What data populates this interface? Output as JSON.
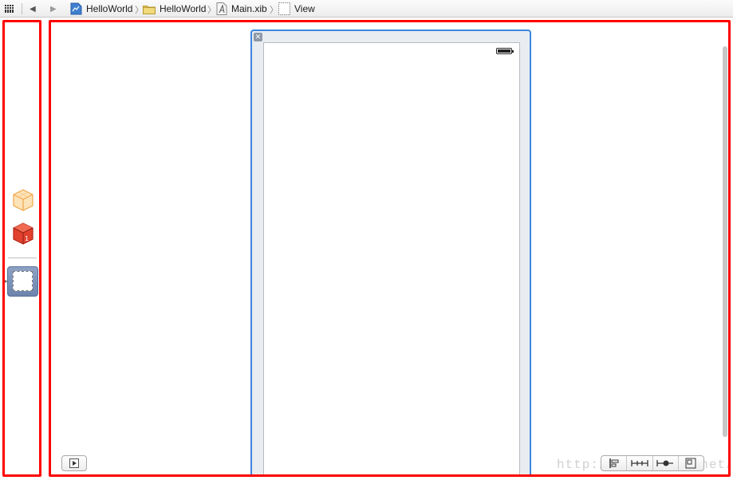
{
  "jump_bar": {
    "related_items_icon": "grid-icon",
    "back_icon": "back-arrow-icon",
    "forward_icon": "forward-arrow-icon",
    "crumbs": [
      {
        "label": "HelloWorld",
        "icon": "project-icon"
      },
      {
        "label": "HelloWorld",
        "icon": "folder-icon"
      },
      {
        "label": "Main.xib",
        "icon": "xib-file-icon"
      },
      {
        "label": "View",
        "icon": "view-icon"
      }
    ]
  },
  "dock": {
    "items": [
      {
        "name": "File's Owner",
        "icon": "files-owner-cube-icon"
      },
      {
        "name": "First Responder",
        "icon": "first-responder-cube-icon"
      },
      {
        "name": "View",
        "icon": "view-object-icon",
        "selected": true
      }
    ]
  },
  "canvas": {
    "view_close_icon": "close-icon",
    "status_bar_icon": "battery-icon",
    "play_icon": "simulated-metrics-icon",
    "layout_buttons": [
      "align-icon",
      "pin-icon",
      "resolve-icon",
      "resizing-icon"
    ],
    "watermark": "http://blog.csdn.net/"
  },
  "colors": {
    "highlight_border": "#ff0000",
    "selection_blue": "#3d86de",
    "dock_selected": "#7a8fb7"
  }
}
